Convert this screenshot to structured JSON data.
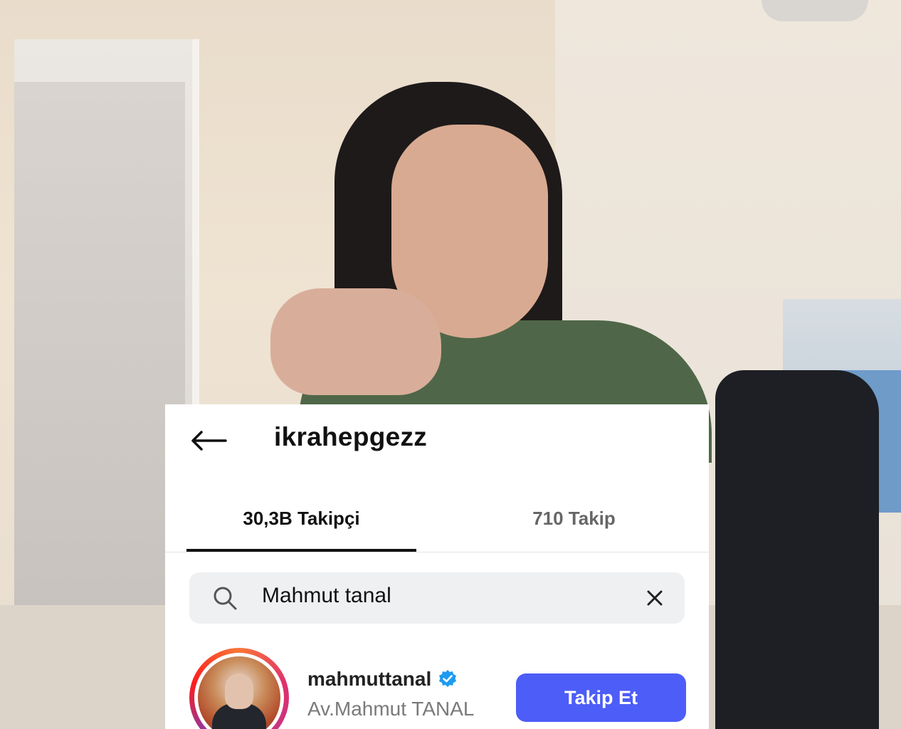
{
  "header": {
    "username": "ikrahepgezz"
  },
  "tabs": [
    {
      "label": "30,3B Takipçi",
      "active": true
    },
    {
      "label": "710 Takip",
      "active": false
    }
  ],
  "search": {
    "value": "Mahmut tanal"
  },
  "result": {
    "username": "mahmuttanal",
    "full_name": "Av.Mahmut TANAL",
    "verified": true,
    "follow_label": "Takip Et"
  },
  "icons": {
    "back": "arrow-left-icon",
    "search": "search-icon",
    "clear": "close-icon",
    "verified": "verified-badge-icon"
  },
  "colors": {
    "follow_button": "#4d5df7",
    "verified_badge": "#1d9bf0",
    "active_tab": "#111111",
    "inactive_tab": "#666666"
  }
}
